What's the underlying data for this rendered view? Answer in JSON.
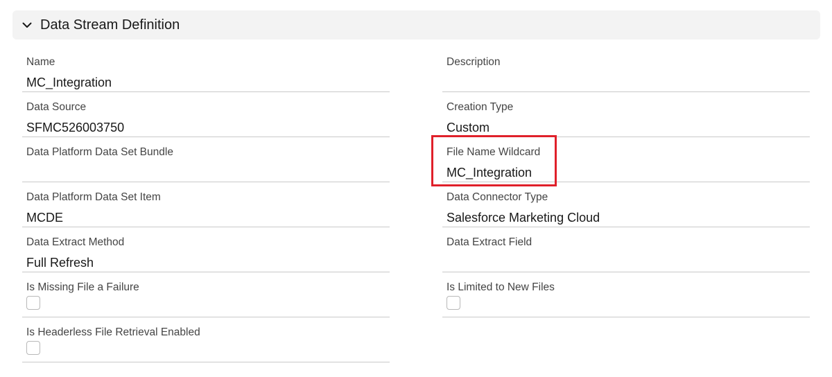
{
  "section": {
    "title": "Data Stream Definition",
    "icon": "chevron-down-icon"
  },
  "fields": {
    "name": {
      "label": "Name",
      "value": "MC_Integration"
    },
    "description": {
      "label": "Description",
      "value": ""
    },
    "data_source": {
      "label": "Data Source",
      "value": "SFMC526003750"
    },
    "creation_type": {
      "label": "Creation Type",
      "value": "Custom"
    },
    "data_set_bundle": {
      "label": "Data Platform Data Set Bundle",
      "value": ""
    },
    "file_name_wildcard": {
      "label": "File Name Wildcard",
      "value": "MC_Integration"
    },
    "data_set_item": {
      "label": "Data Platform Data Set Item",
      "value": "MCDE"
    },
    "connector_type": {
      "label": "Data Connector Type",
      "value": "Salesforce Marketing Cloud"
    },
    "extract_method": {
      "label": "Data Extract Method",
      "value": "Full Refresh"
    },
    "extract_field": {
      "label": "Data Extract Field",
      "value": ""
    },
    "missing_file_failure": {
      "label": "Is Missing File a Failure",
      "checked": false
    },
    "limited_new_files": {
      "label": "Is Limited to New Files",
      "checked": false
    },
    "headerless_retrieval": {
      "label": "Is Headerless File Retrieval Enabled",
      "checked": false
    }
  },
  "colors": {
    "header_bg": "#f3f3f3",
    "highlight_border": "#e0202a",
    "divider": "#c9c9c9"
  }
}
